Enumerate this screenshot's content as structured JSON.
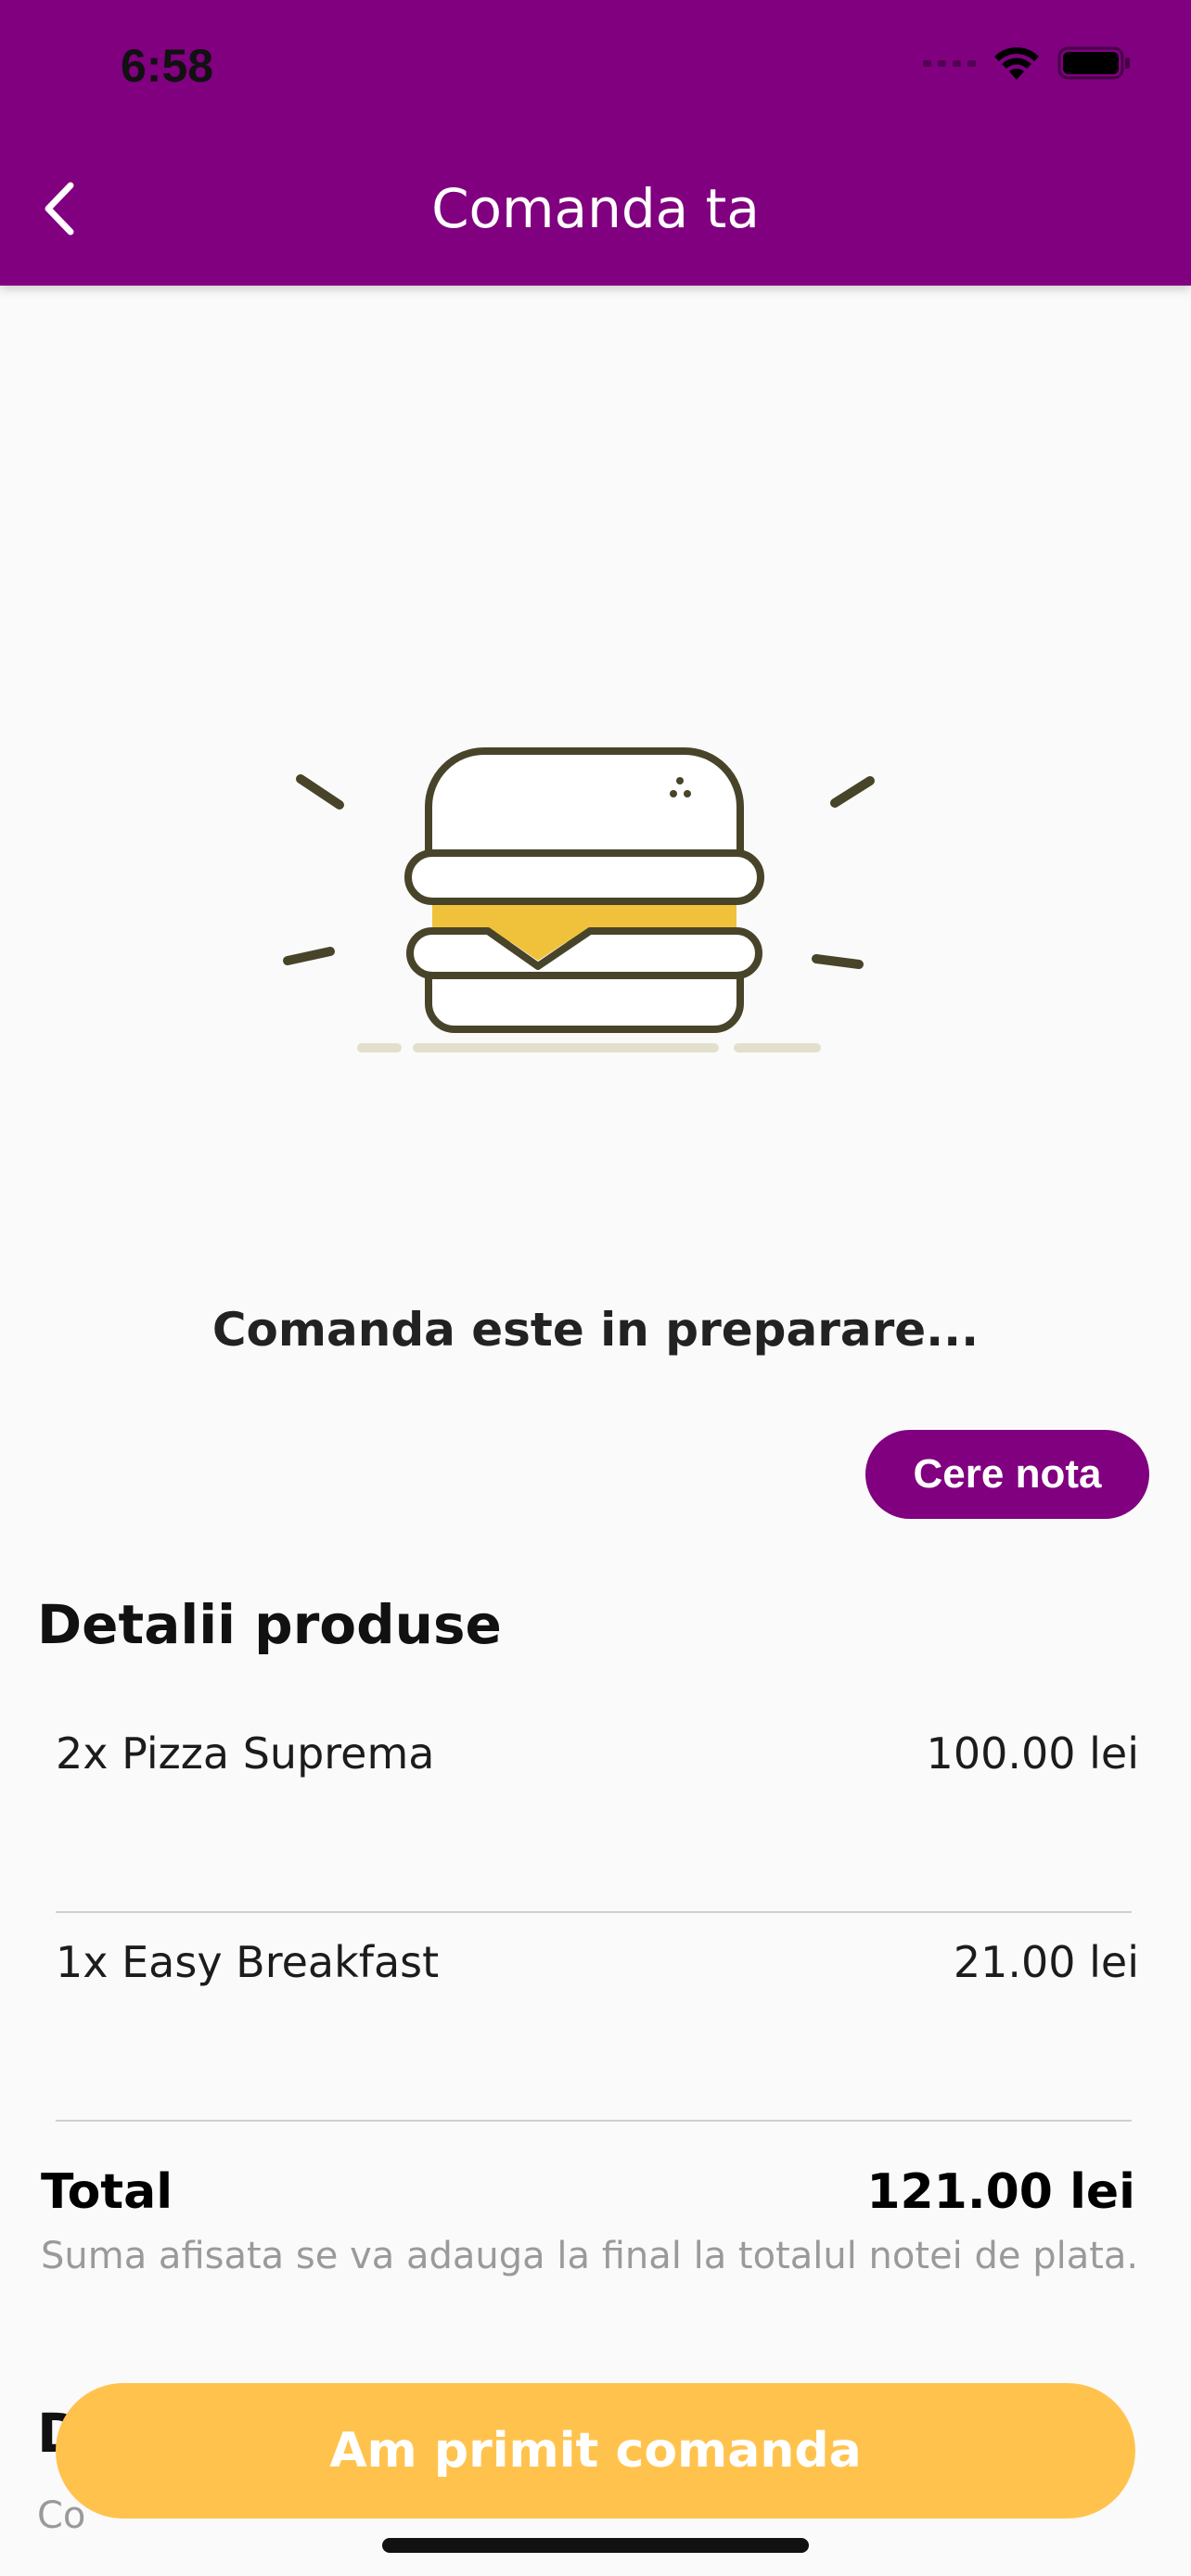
{
  "status_bar": {
    "time": "6:58",
    "icons": [
      "signal-icon",
      "wifi-icon",
      "battery-icon"
    ]
  },
  "header": {
    "title": "Comanda ta",
    "back_icon": "chevron-left-icon",
    "background_color": "#800080"
  },
  "illustration": {
    "icon": "burger-icon"
  },
  "order_status": {
    "message": "Comanda este in preparare..."
  },
  "bill_button": {
    "label": "Cere nota"
  },
  "products": {
    "section_title": "Detalii produse",
    "items": [
      {
        "name": "2x Pizza Suprema",
        "price": "100.00 lei"
      },
      {
        "name": "1x Easy Breakfast",
        "price": "21.00 lei"
      }
    ]
  },
  "total": {
    "label": "Total",
    "value": "121.00 lei",
    "note": "Suma afisata se va adauga la final la totalul notei de plata."
  },
  "next_section": {
    "title_partial": "D",
    "subtitle_partial": "Co"
  },
  "confirm_button": {
    "label": "Am primit comanda",
    "color": "#ffc34d"
  }
}
